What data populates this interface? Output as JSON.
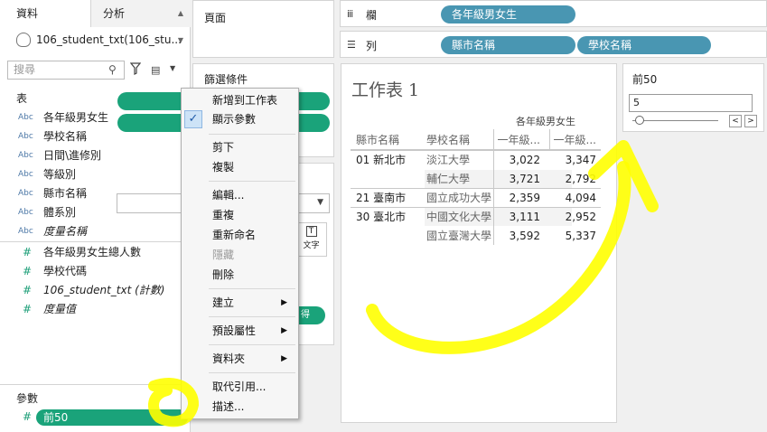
{
  "left_pane": {
    "tabs": {
      "data": "資料",
      "analysis": "分析"
    },
    "datasource": "106_student_txt(106_stu...",
    "search_placeholder": "搜尋",
    "dimensions_header": "表",
    "dimensions": [
      {
        "type": "Abc",
        "name": "各年級男女生",
        "italic": false
      },
      {
        "type": "Abc",
        "name": "學校名稱",
        "italic": false
      },
      {
        "type": "Abc",
        "name": "日間\\進修別",
        "italic": false
      },
      {
        "type": "Abc",
        "name": "等級別",
        "italic": false
      },
      {
        "type": "Abc",
        "name": "縣市名稱",
        "italic": false
      },
      {
        "type": "Abc",
        "name": "體系別",
        "italic": false
      },
      {
        "type": "Abc",
        "name": "度量名稱",
        "italic": true
      }
    ],
    "measures": [
      {
        "type": "#",
        "name": "各年級男女生總人數",
        "italic": false
      },
      {
        "type": "#",
        "name": "學校代碼",
        "italic": false
      },
      {
        "type": "#",
        "name": "106_student_txt (計數)",
        "italic": true
      },
      {
        "type": "#",
        "name": "度量值",
        "italic": true
      }
    ],
    "parameters_header": "參數",
    "parameter": {
      "type": "#",
      "name": "前50"
    }
  },
  "pages_shelf": {
    "label": "頁面"
  },
  "filters_shelf": {
    "label": "篩選條件"
  },
  "marks": {
    "text_button": "文字",
    "pill_text": "得"
  },
  "columns_shelf": {
    "icon": "iii",
    "label": "欄",
    "pills": [
      "各年級男女生"
    ]
  },
  "rows_shelf": {
    "icon": "☰",
    "label": "列",
    "pills": [
      "縣市名稱",
      "學校名稱"
    ]
  },
  "worksheet": {
    "title": "工作表 1",
    "measure_header": "各年級男女生",
    "col_headers": [
      "縣市名稱",
      "學校名稱",
      "一年級...",
      "一年級..."
    ],
    "rows": [
      {
        "county": "01 新北市",
        "school": "淡江大學",
        "v1": "3,022",
        "v2": "3,347"
      },
      {
        "county": "",
        "school": "輔仁大學",
        "v1": "3,721",
        "v2": "2,792"
      },
      {
        "county": "21 臺南市",
        "school": "國立成功大學",
        "v1": "2,359",
        "v2": "4,094"
      },
      {
        "county": "30 臺北市",
        "school": "中國文化大學",
        "v1": "3,111",
        "v2": "2,952"
      },
      {
        "county": "",
        "school": "國立臺灣大學",
        "v1": "3,592",
        "v2": "5,337"
      }
    ]
  },
  "parameter_control": {
    "title": "前50",
    "value": "5",
    "prev": "<",
    "next": ">"
  },
  "context_menu": {
    "items": [
      {
        "label": "新增到工作表",
        "disabled": false,
        "submenu": false
      },
      {
        "label": "顯示參數",
        "disabled": false,
        "submenu": false,
        "checked": true
      },
      {
        "label": "剪下",
        "disabled": false,
        "submenu": false
      },
      {
        "label": "複製",
        "disabled": false,
        "submenu": false
      },
      {
        "label": "編輯...",
        "disabled": false,
        "submenu": false
      },
      {
        "label": "重複",
        "disabled": false,
        "submenu": false
      },
      {
        "label": "重新命名",
        "disabled": false,
        "submenu": false
      },
      {
        "label": "隱藏",
        "disabled": true,
        "submenu": false
      },
      {
        "label": "刪除",
        "disabled": false,
        "submenu": false
      },
      {
        "label": "建立",
        "disabled": false,
        "submenu": true
      },
      {
        "label": "預設屬性",
        "disabled": false,
        "submenu": true
      },
      {
        "label": "資料夾",
        "disabled": false,
        "submenu": true
      },
      {
        "label": "取代引用...",
        "disabled": false,
        "submenu": false
      },
      {
        "label": "描述...",
        "disabled": false,
        "submenu": false
      }
    ]
  },
  "colors": {
    "dimension_pill": "#4996b2",
    "measure_pill": "#1aa37a",
    "highlighter": "#ffff00"
  }
}
